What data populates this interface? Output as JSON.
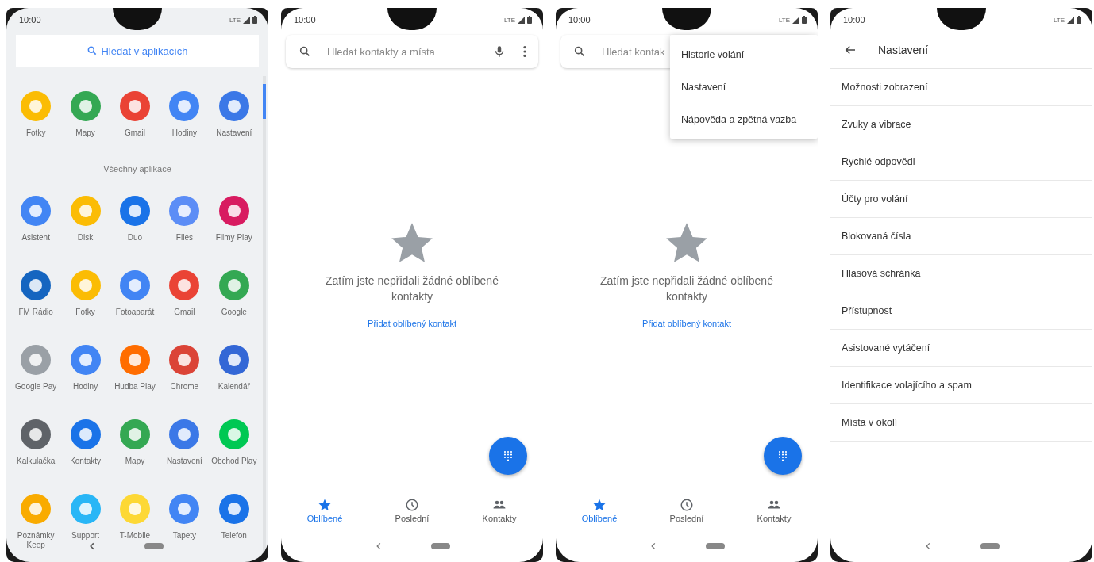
{
  "phones": [
    {
      "kind": "app_drawer",
      "status": {
        "time": "10:00",
        "network": "LTE"
      },
      "search": {
        "label": "Hledat v aplikacích"
      },
      "favorites": [
        {
          "label": "Fotky",
          "color": "#fbbc04"
        },
        {
          "label": "Mapy",
          "color": "#34a853"
        },
        {
          "label": "Gmail",
          "color": "#ea4335"
        },
        {
          "label": "Hodiny",
          "color": "#4285f4"
        },
        {
          "label": "Nastavení",
          "color": "#3b78e7"
        }
      ],
      "section_title": "Všechny aplikace",
      "apps": [
        {
          "label": "Asistent",
          "color": "#4285f4"
        },
        {
          "label": "Disk",
          "color": "#fbbc04"
        },
        {
          "label": "Duo",
          "color": "#1a73e8"
        },
        {
          "label": "Files",
          "color": "#5c8df6"
        },
        {
          "label": "Filmy Play",
          "color": "#d81b60"
        },
        {
          "label": "FM Rádio",
          "color": "#1565c0"
        },
        {
          "label": "Fotky",
          "color": "#fbbc04"
        },
        {
          "label": "Fotoaparát",
          "color": "#4285f4"
        },
        {
          "label": "Gmail",
          "color": "#ea4335"
        },
        {
          "label": "Google",
          "color": "#34a853"
        },
        {
          "label": "Google Pay",
          "color": "#9aa0a6"
        },
        {
          "label": "Hodiny",
          "color": "#4285f4"
        },
        {
          "label": "Hudba Play",
          "color": "#ff6d00"
        },
        {
          "label": "Chrome",
          "color": "#db4437"
        },
        {
          "label": "Kalendář",
          "color": "#3367d6"
        },
        {
          "label": "Kalkulačka",
          "color": "#5f6368"
        },
        {
          "label": "Kontakty",
          "color": "#1a73e8"
        },
        {
          "label": "Mapy",
          "color": "#34a853"
        },
        {
          "label": "Nastavení",
          "color": "#3b78e7"
        },
        {
          "label": "Obchod Play",
          "color": "#00c853"
        },
        {
          "label": "Poznámky Keep",
          "color": "#f9ab00"
        },
        {
          "label": "Support",
          "color": "#29b6f6"
        },
        {
          "label": "T-Mobile",
          "color": "#fdd835"
        },
        {
          "label": "Tapety",
          "color": "#4285f4"
        },
        {
          "label": "Telefon",
          "color": "#1a73e8"
        }
      ]
    },
    {
      "kind": "favorites",
      "status": {
        "time": "10:00",
        "network": "LTE"
      },
      "search": {
        "placeholder": "Hledat kontakty a místa"
      },
      "empty_message": "Zatím jste nepřidali žádné oblíbené kontakty",
      "add_link": "Přidat oblíbený kontakt",
      "tabs": [
        {
          "label": "Oblíbené",
          "kind": "star",
          "selected": true
        },
        {
          "label": "Poslední",
          "kind": "clock",
          "selected": false
        },
        {
          "label": "Kontakty",
          "kind": "people",
          "selected": false
        }
      ]
    },
    {
      "kind": "favorites",
      "status": {
        "time": "10:00",
        "network": "LTE"
      },
      "search": {
        "placeholder": "Hledat kontak"
      },
      "empty_message": "Zatím jste nepřidali žádné oblíbené kontakty",
      "add_link": "Přidat oblíbený kontakt",
      "tabs": [
        {
          "label": "Oblíbené",
          "kind": "star",
          "selected": true
        },
        {
          "label": "Poslední",
          "kind": "clock",
          "selected": false
        },
        {
          "label": "Kontakty",
          "kind": "people",
          "selected": false
        }
      ],
      "menu": [
        "Historie volání",
        "Nastavení",
        "Nápověda a zpětná vazba"
      ]
    },
    {
      "kind": "settings",
      "status": {
        "time": "10:00",
        "network": "LTE"
      },
      "title": "Nastavení",
      "items": [
        "Možnosti zobrazení",
        "Zvuky a vibrace",
        "Rychlé odpovědi",
        "Účty pro volání",
        "Blokovaná čísla",
        "Hlasová schránka",
        "Přístupnost",
        "Asistované vytáčení",
        "Identifikace volajícího a spam",
        "Místa v okolí"
      ]
    }
  ]
}
